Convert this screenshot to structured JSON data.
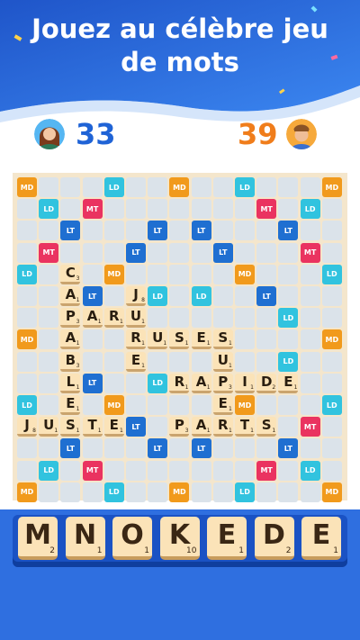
{
  "headline": {
    "line1": "Jouez au célèbre jeu",
    "line2": "de mots"
  },
  "players": {
    "left": {
      "score": "33",
      "avatar_icon": "woman-avatar-icon",
      "score_color": "#1f63d6"
    },
    "right": {
      "score": "39",
      "avatar_icon": "man-avatar-icon",
      "score_color": "#f07d1b"
    }
  },
  "colors": {
    "hero_blue": "#2a6be0",
    "tile": "#fbe3b8",
    "cell": "#dbe3ea",
    "MD": "#f19a1c",
    "LD": "#31c3df",
    "LT": "#1f6fd1",
    "MT": "#ea3360"
  },
  "board": {
    "grid_size": 15,
    "bonus_labels": {
      "MD": "MD",
      "LD": "LD",
      "LT": "LT",
      "MT": "MT"
    },
    "placed_words": [
      "CAPABLE",
      "PARU",
      "JURES",
      "RUSES",
      "RAPIDE",
      "JUSTE",
      "PARTS"
    ],
    "tiles": [
      {
        "r": 4,
        "c": 2,
        "l": "C",
        "p": "3"
      },
      {
        "r": 5,
        "c": 2,
        "l": "A",
        "p": "1"
      },
      {
        "r": 5,
        "c": 5,
        "l": "J",
        "p": "8"
      },
      {
        "r": 6,
        "c": 2,
        "l": "P",
        "p": "3"
      },
      {
        "r": 6,
        "c": 3,
        "l": "A",
        "p": "1"
      },
      {
        "r": 6,
        "c": 4,
        "l": "R",
        "p": "1"
      },
      {
        "r": 6,
        "c": 5,
        "l": "U",
        "p": "1"
      },
      {
        "r": 7,
        "c": 2,
        "l": "A",
        "p": "1"
      },
      {
        "r": 7,
        "c": 5,
        "l": "R",
        "p": "1"
      },
      {
        "r": 7,
        "c": 6,
        "l": "U",
        "p": "1"
      },
      {
        "r": 7,
        "c": 7,
        "l": "S",
        "p": "1"
      },
      {
        "r": 7,
        "c": 8,
        "l": "E",
        "p": "1"
      },
      {
        "r": 7,
        "c": 9,
        "l": "S",
        "p": "1"
      },
      {
        "r": 8,
        "c": 2,
        "l": "B",
        "p": "3"
      },
      {
        "r": 8,
        "c": 5,
        "l": "E",
        "p": "1"
      },
      {
        "r": 8,
        "c": 9,
        "l": "U",
        "p": "1"
      },
      {
        "r": 9,
        "c": 2,
        "l": "L",
        "p": "1"
      },
      {
        "r": 9,
        "c": 7,
        "l": "R",
        "p": "1"
      },
      {
        "r": 9,
        "c": 8,
        "l": "A",
        "p": "1"
      },
      {
        "r": 9,
        "c": 9,
        "l": "P",
        "p": "3"
      },
      {
        "r": 9,
        "c": 10,
        "l": "I",
        "p": "1"
      },
      {
        "r": 9,
        "c": 11,
        "l": "D",
        "p": "2"
      },
      {
        "r": 9,
        "c": 12,
        "l": "E",
        "p": "1"
      },
      {
        "r": 10,
        "c": 2,
        "l": "E",
        "p": "1"
      },
      {
        "r": 10,
        "c": 9,
        "l": "E",
        "p": "1"
      },
      {
        "r": 11,
        "c": 0,
        "l": "J",
        "p": "8"
      },
      {
        "r": 11,
        "c": 1,
        "l": "U",
        "p": "1"
      },
      {
        "r": 11,
        "c": 2,
        "l": "S",
        "p": "1"
      },
      {
        "r": 11,
        "c": 3,
        "l": "T",
        "p": "1"
      },
      {
        "r": 11,
        "c": 4,
        "l": "E",
        "p": "1"
      },
      {
        "r": 11,
        "c": 7,
        "l": "P",
        "p": "3"
      },
      {
        "r": 11,
        "c": 8,
        "l": "A",
        "p": "1"
      },
      {
        "r": 11,
        "c": 9,
        "l": "R",
        "p": "1"
      },
      {
        "r": 11,
        "c": 10,
        "l": "T",
        "p": "1"
      },
      {
        "r": 11,
        "c": 11,
        "l": "S",
        "p": "1"
      }
    ],
    "bonuses": [
      {
        "r": 0,
        "c": 0,
        "t": "MD"
      },
      {
        "r": 0,
        "c": 4,
        "t": "LD"
      },
      {
        "r": 0,
        "c": 7,
        "t": "MD"
      },
      {
        "r": 0,
        "c": 10,
        "t": "LD"
      },
      {
        "r": 0,
        "c": 14,
        "t": "MD"
      },
      {
        "r": 1,
        "c": 1,
        "t": "LD"
      },
      {
        "r": 1,
        "c": 3,
        "t": "MT"
      },
      {
        "r": 1,
        "c": 11,
        "t": "MT"
      },
      {
        "r": 1,
        "c": 13,
        "t": "LD"
      },
      {
        "r": 2,
        "c": 2,
        "t": "LT"
      },
      {
        "r": 2,
        "c": 6,
        "t": "LT"
      },
      {
        "r": 2,
        "c": 8,
        "t": "LT"
      },
      {
        "r": 2,
        "c": 12,
        "t": "LT"
      },
      {
        "r": 3,
        "c": 1,
        "t": "MT"
      },
      {
        "r": 3,
        "c": 5,
        "t": "LT"
      },
      {
        "r": 3,
        "c": 9,
        "t": "LT"
      },
      {
        "r": 3,
        "c": 13,
        "t": "MT"
      },
      {
        "r": 4,
        "c": 0,
        "t": "LD"
      },
      {
        "r": 4,
        "c": 4,
        "t": "MD"
      },
      {
        "r": 4,
        "c": 10,
        "t": "MD"
      },
      {
        "r": 4,
        "c": 14,
        "t": "LD"
      },
      {
        "r": 5,
        "c": 3,
        "t": "LT"
      },
      {
        "r": 5,
        "c": 6,
        "t": "LD"
      },
      {
        "r": 5,
        "c": 8,
        "t": "LD"
      },
      {
        "r": 5,
        "c": 11,
        "t": "LT"
      },
      {
        "r": 6,
        "c": 12,
        "t": "LD"
      },
      {
        "r": 7,
        "c": 0,
        "t": "MD"
      },
      {
        "r": 7,
        "c": 14,
        "t": "MD"
      },
      {
        "r": 8,
        "c": 12,
        "t": "LD"
      },
      {
        "r": 9,
        "c": 3,
        "t": "LT"
      },
      {
        "r": 9,
        "c": 6,
        "t": "LD"
      },
      {
        "r": 10,
        "c": 0,
        "t": "LD"
      },
      {
        "r": 10,
        "c": 4,
        "t": "MD"
      },
      {
        "r": 10,
        "c": 10,
        "t": "MD"
      },
      {
        "r": 10,
        "c": 14,
        "t": "LD"
      },
      {
        "r": 11,
        "c": 5,
        "t": "LT"
      },
      {
        "r": 11,
        "c": 13,
        "t": "MT"
      },
      {
        "r": 12,
        "c": 2,
        "t": "LT"
      },
      {
        "r": 12,
        "c": 6,
        "t": "LT"
      },
      {
        "r": 12,
        "c": 8,
        "t": "LT"
      },
      {
        "r": 12,
        "c": 12,
        "t": "LT"
      },
      {
        "r": 13,
        "c": 1,
        "t": "LD"
      },
      {
        "r": 13,
        "c": 3,
        "t": "MT"
      },
      {
        "r": 13,
        "c": 11,
        "t": "MT"
      },
      {
        "r": 13,
        "c": 13,
        "t": "LD"
      },
      {
        "r": 14,
        "c": 0,
        "t": "MD"
      },
      {
        "r": 14,
        "c": 4,
        "t": "LD"
      },
      {
        "r": 14,
        "c": 7,
        "t": "MD"
      },
      {
        "r": 14,
        "c": 10,
        "t": "LD"
      },
      {
        "r": 14,
        "c": 14,
        "t": "MD"
      }
    ]
  },
  "rack": [
    {
      "l": "M",
      "p": "2"
    },
    {
      "l": "N",
      "p": "1"
    },
    {
      "l": "O",
      "p": "1"
    },
    {
      "l": "K",
      "p": "10"
    },
    {
      "l": "E",
      "p": "1"
    },
    {
      "l": "D",
      "p": "2"
    },
    {
      "l": "E",
      "p": "1"
    }
  ]
}
